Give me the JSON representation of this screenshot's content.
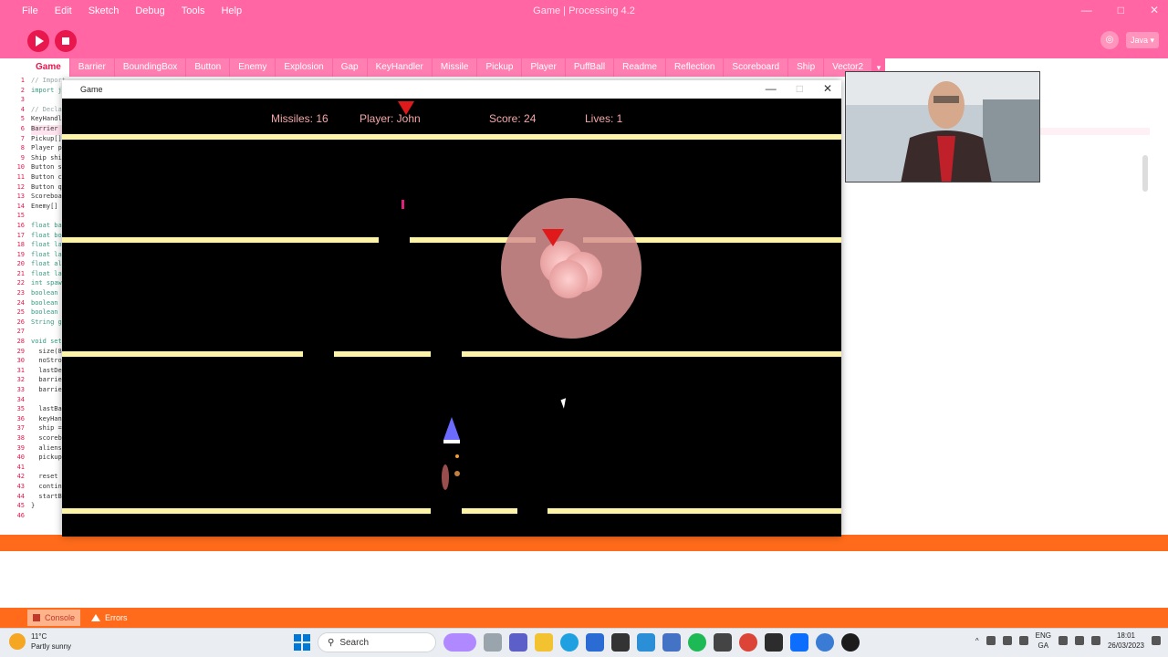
{
  "ide": {
    "title": "Game | Processing 4.2",
    "menu": [
      "File",
      "Edit",
      "Sketch",
      "Debug",
      "Tools",
      "Help"
    ],
    "mode": "Java ▾",
    "tabs": [
      "Game",
      "Barrier",
      "BoundingBox",
      "Button",
      "Enemy",
      "Explosion",
      "Gap",
      "KeyHandler",
      "Missile",
      "Pickup",
      "Player",
      "PuffBall",
      "Readme",
      "Reflection",
      "Scoreboard",
      "Ship",
      "Vector2"
    ],
    "active_tab": "Game",
    "tabs_more": "▾",
    "code_lines": [
      "// Import",
      "import j",
      "",
      "// Decla",
      "KeyHandl",
      "Barrier",
      "Pickup[]",
      "Player p",
      "Ship shi",
      "Button s",
      "Button c",
      "Button q",
      "Scoreboa",
      "Enemy[]",
      "",
      "float ba",
      "float bo",
      "float la",
      "float la",
      "float al",
      "float la",
      "int spaw",
      "boolean",
      "boolean",
      "boolean",
      "String g",
      "",
      "void set",
      "  size(8",
      "  noStro",
      "  lastDe",
      "  barrie",
      "  barrie",
      "",
      "  lastBa",
      "  keyHan",
      "  ship =",
      "  scoreb",
      "  aliens",
      "  pickup",
      "",
      "  reset",
      "  contin",
      "  startB",
      "}",
      ""
    ],
    "line_numbers": [
      "1",
      "2",
      "3",
      "4",
      "5",
      "6",
      "7",
      "8",
      "9",
      "10",
      "11",
      "12",
      "13",
      "14",
      "15",
      "16",
      "17",
      "18",
      "19",
      "20",
      "21",
      "22",
      "23",
      "24",
      "25",
      "26",
      "27",
      "28",
      "29",
      "30",
      "31",
      "32",
      "33",
      "34",
      "35",
      "36",
      "37",
      "38",
      "39",
      "40",
      "41",
      "42",
      "43",
      "44",
      "45",
      "46"
    ],
    "console_tab": "Console",
    "errors_tab": "Errors"
  },
  "game_window": {
    "title": "Game",
    "hud": {
      "missiles": "Missiles: 16",
      "player": "Player: John",
      "score": "Score: 24",
      "lives": "Lives: 1"
    }
  },
  "colors": {
    "ide_accent": "#ff66a3",
    "run_button": "#e8174d",
    "status_orange": "#ff6b1a",
    "barrier": "#fdf4a8",
    "ship": "#6b6bff",
    "enemy": "#e01a1a",
    "explosion": "#f2b8b8"
  },
  "taskbar": {
    "weather_temp": "11°C",
    "weather_desc": "Partly sunny",
    "search": "Search",
    "lang_top": "ENG",
    "lang_bottom": "GA",
    "time": "18:01",
    "date": "26/03/2023"
  }
}
